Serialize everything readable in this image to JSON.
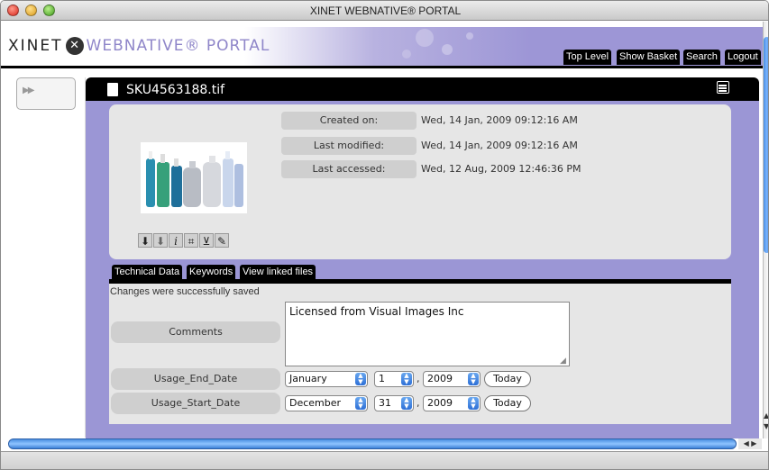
{
  "window": {
    "title": "XINET WEBNATIVE® PORTAL"
  },
  "header": {
    "logo_left": "XINET",
    "logo_mark": "✕",
    "logo_right": "WEBNATIVE® PORTAL",
    "nav": [
      "Top Level",
      "Show Basket",
      "Search",
      "Logout"
    ]
  },
  "file": {
    "name": "SKU4563188.tif",
    "meta": [
      {
        "label": "Created on:",
        "value": "Wed, 14 Jan, 2009 09:12:16 AM"
      },
      {
        "label": "Last modified:",
        "value": "Wed, 14 Jan, 2009 09:12:16 AM"
      },
      {
        "label": "Last accessed:",
        "value": "Wed, 12 Aug, 2009 12:46:36 PM"
      }
    ]
  },
  "tabs": [
    "Technical Data",
    "Keywords",
    "View linked files"
  ],
  "form": {
    "message": "Changes were successfully saved",
    "comments_label": "Comments",
    "comments_value": "Licensed from Visual Images Inc",
    "usage_end": {
      "label": "Usage_End_Date",
      "month": "January",
      "day": "1",
      "year": "2009",
      "today": "Today"
    },
    "usage_start": {
      "label": "Usage_Start_Date",
      "month": "December",
      "day": "31",
      "year": "2009",
      "today": "Today"
    }
  },
  "colors": {
    "accent": "#9b96d5",
    "panel": "#e6e6e6",
    "scroll": "#4a8ee0"
  }
}
